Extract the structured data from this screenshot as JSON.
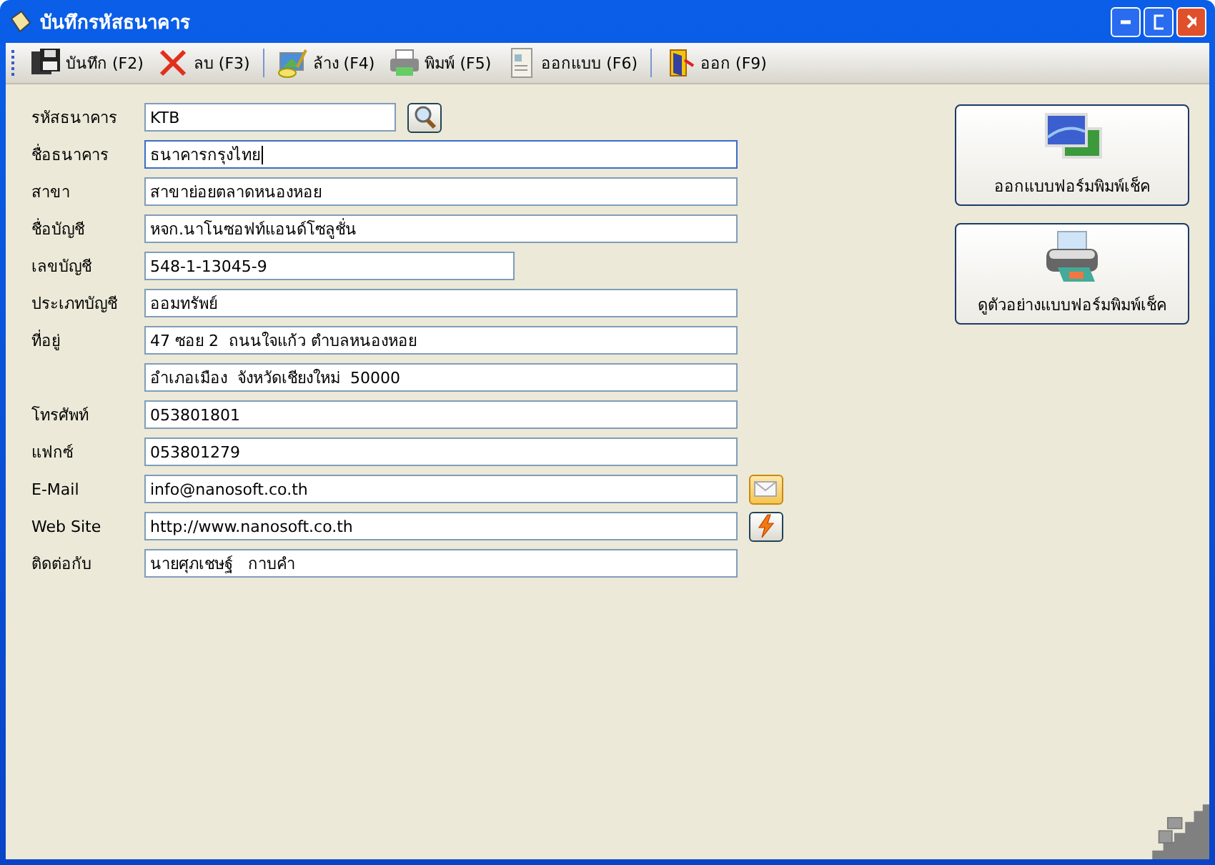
{
  "window": {
    "title": "บันทึกรหัสธนาคาร"
  },
  "toolbar": {
    "groups": [
      {
        "items": [
          {
            "label": "บันทึก (F2)"
          },
          {
            "label": "ลบ (F3)"
          }
        ]
      },
      {
        "items": [
          {
            "label": "ล้าง (F4)"
          },
          {
            "label": "พิมพ์ (F5)"
          },
          {
            "label": "ออกแบบ (F6)"
          }
        ]
      },
      {
        "items": [
          {
            "label": "ออก (F9)"
          }
        ]
      }
    ]
  },
  "form": {
    "fields": [
      {
        "label": "รหัสธนาคาร",
        "value": "KTB",
        "kind": "lookup",
        "focused": false
      },
      {
        "label": "ชื่อธนาคาร",
        "value": "ธนาคารกรุงไทย",
        "kind": "text",
        "focused": true
      },
      {
        "label": "สาขา",
        "value": "สาขาย่อยตลาดหนองหอย",
        "kind": "text",
        "focused": false
      },
      {
        "label": "ชื่อบัญชี",
        "value": "หจก.นาโนซอฟท์แอนด์โซลูชั่น",
        "kind": "text",
        "focused": false
      },
      {
        "label": "เลขบัญชี",
        "value": "548-1-13045-9",
        "kind": "number",
        "focused": false
      },
      {
        "label": "ประเภทบัญชี",
        "value": "ออมทรัพย์",
        "kind": "text",
        "focused": false
      },
      {
        "label": "ที่อยู่",
        "value": "47 ซอย 2  ถนนใจแก้ว ตำบลหนองหอย",
        "kind": "text",
        "focused": false
      },
      {
        "value": "อำเภอเมือง  จังหวัดเชียงใหม่  50000",
        "kind": "text",
        "focused": false
      },
      {
        "label": "โทรศัพท์",
        "value": "053801801",
        "kind": "text",
        "focused": false
      },
      {
        "label": "แฟกซ์",
        "value": "053801279",
        "kind": "text",
        "focused": false
      },
      {
        "label": "E-Mail",
        "value": "info@nanosoft.co.th",
        "kind": "email",
        "focused": false
      },
      {
        "label": "Web Site",
        "value": "http://www.nanosoft.co.th",
        "kind": "web",
        "focused": false
      },
      {
        "label": "ติดต่อกับ",
        "value": "นายศุภเชษฐ์   กาบคำ",
        "kind": "text",
        "focused": false
      }
    ]
  },
  "side_buttons": [
    {
      "label": "ออกแบบฟอร์มพิมพ์เช็ค"
    },
    {
      "label": "ดูตัวอย่างแบบฟอร์มพิมพ์เช็ค"
    }
  ]
}
